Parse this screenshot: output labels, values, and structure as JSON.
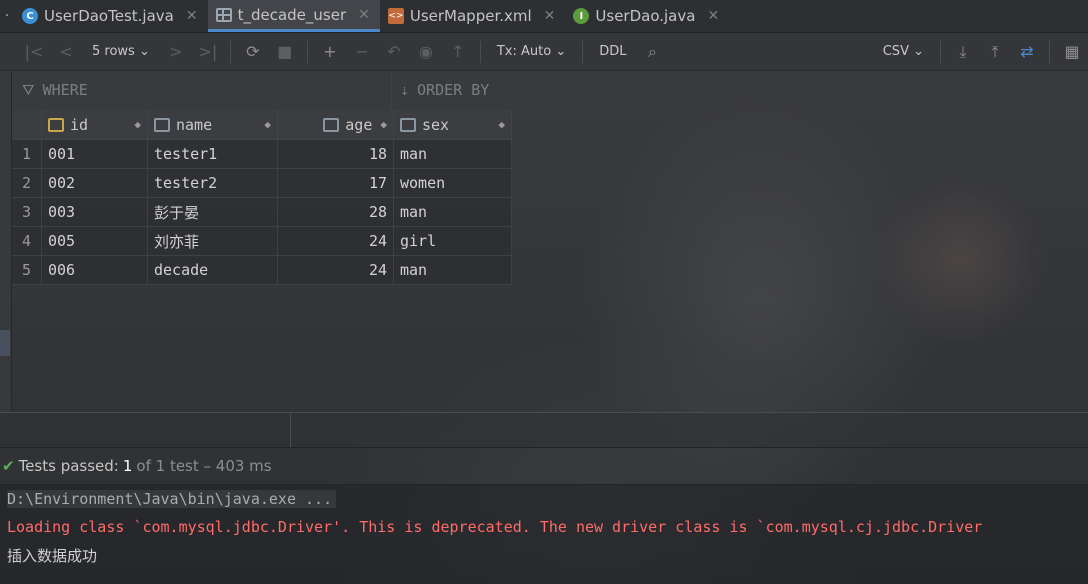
{
  "tabs": [
    {
      "label": "UserDaoTest.java",
      "icon": "class-c-icon",
      "active": false
    },
    {
      "label": "t_decade_user",
      "icon": "table-icon",
      "active": true
    },
    {
      "label": "UserMapper.xml",
      "icon": "xml-file-icon",
      "active": false
    },
    {
      "label": "UserDao.java",
      "icon": "interface-i-icon",
      "active": false
    }
  ],
  "toolbar": {
    "rows_label": "5 rows",
    "tx_label": "Tx: Auto",
    "ddl_label": "DDL",
    "export_format": "CSV"
  },
  "filter": {
    "where_label": "WHERE",
    "order_label": "ORDER BY"
  },
  "table": {
    "columns": [
      "id",
      "name",
      "age",
      "sex"
    ],
    "rows": [
      {
        "num": "1",
        "id": "001",
        "name": "tester1",
        "age": "18",
        "sex": "man"
      },
      {
        "num": "2",
        "id": "002",
        "name": "tester2",
        "age": "17",
        "sex": "women"
      },
      {
        "num": "3",
        "id": "003",
        "name": "彭于晏",
        "age": "28",
        "sex": "man"
      },
      {
        "num": "4",
        "id": "005",
        "name": "刘亦菲",
        "age": "24",
        "sex": "girl"
      },
      {
        "num": "5",
        "id": "006",
        "name": "decade",
        "age": "24",
        "sex": "man"
      }
    ]
  },
  "test_status": {
    "passed_label": "Tests passed:",
    "count": "1",
    "rest": "of 1 test – 403 ms"
  },
  "console": {
    "command": "D:\\Environment\\Java\\bin\\java.exe ...",
    "warning": "Loading class `com.mysql.jdbc.Driver'. This is deprecated. The new driver class is `com.mysql.cj.jdbc.Driver",
    "output": "插入数据成功"
  },
  "colors": {
    "accent": "#4a88c7",
    "error": "#ff6b68",
    "success": "#5fae5f"
  }
}
